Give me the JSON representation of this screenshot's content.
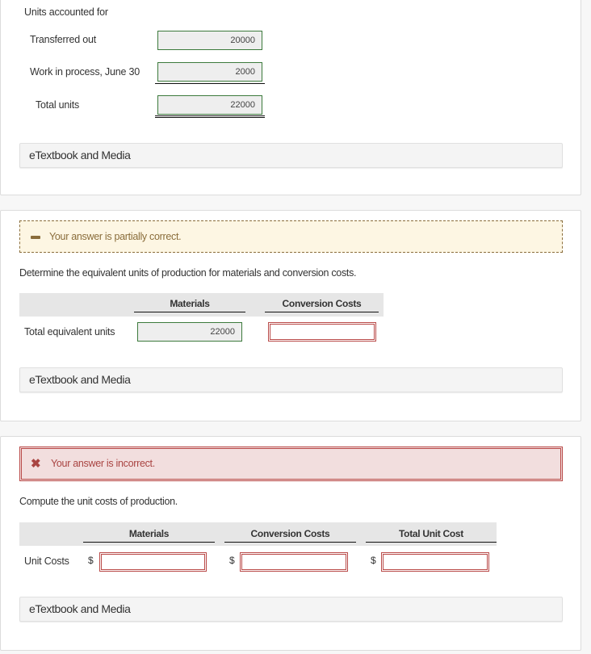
{
  "section1": {
    "heading": "Units accounted for",
    "rows": [
      {
        "label": "Transferred out",
        "value": "20000"
      },
      {
        "label": "Work in process, June 30",
        "value": "2000"
      },
      {
        "label": "Total units",
        "value": "22000"
      }
    ],
    "etextbook_label": "eTextbook and Media"
  },
  "section2": {
    "feedback": {
      "status": "partial",
      "icon": "minus-icon",
      "message": "Your answer is partially correct."
    },
    "prompt": "Determine the equivalent units of production for materials and conversion costs.",
    "columns": [
      "Materials",
      "Conversion Costs"
    ],
    "row": {
      "label": "Total equivalent units",
      "materials": "22000",
      "conversion_costs": ""
    },
    "etextbook_label": "eTextbook and Media"
  },
  "section3": {
    "feedback": {
      "status": "incorrect",
      "icon": "x-icon",
      "message": "Your answer is incorrect."
    },
    "prompt": "Compute the unit costs of production.",
    "columns": [
      "Materials",
      "Conversion Costs",
      "Total Unit Cost"
    ],
    "row": {
      "label": "Unit Costs",
      "currency": "$",
      "materials": "",
      "conversion_costs": "",
      "total_unit_cost": ""
    },
    "etextbook_label": "eTextbook and Media"
  },
  "colors": {
    "correct_border": "#3c7a3c",
    "incorrect_border": "#b94a48",
    "partial_text": "#8a6d3b",
    "partial_bg": "#fdf6e3",
    "incorrect_bg": "#f2dede"
  }
}
